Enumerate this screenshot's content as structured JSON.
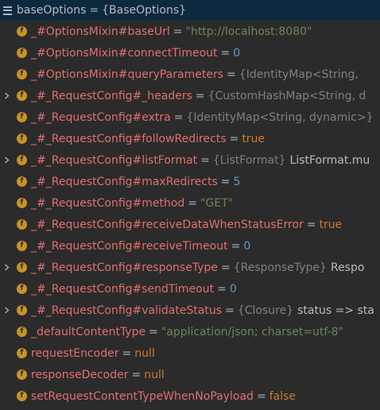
{
  "root": {
    "name": "baseOptions",
    "type": "{BaseOptions}"
  },
  "rows": [
    {
      "name": "_#OptionsMixin#baseUrl",
      "kind": "str",
      "value": "\"http://localhost:8080\"",
      "expandable": false
    },
    {
      "name": "_#OptionsMixin#connectTimeout",
      "kind": "num",
      "value": "0",
      "expandable": false
    },
    {
      "name": "_#OptionsMixin#queryParameters",
      "kind": "type",
      "type": "{IdentityMap<String,",
      "value": "",
      "expandable": false
    },
    {
      "name": "_#_RequestConfig#_headers",
      "kind": "type",
      "type": "{CustomHashMap<String, d",
      "value": "",
      "expandable": true
    },
    {
      "name": "_#_RequestConfig#extra",
      "kind": "type",
      "type": "{IdentityMap<String, dynamic>}",
      "value": "",
      "expandable": false
    },
    {
      "name": "_#_RequestConfig#followRedirects",
      "kind": "kw",
      "value": "true",
      "expandable": false
    },
    {
      "name": "_#_RequestConfig#listFormat",
      "kind": "type",
      "type": "{ListFormat}",
      "value": "ListFormat.mu",
      "expandable": true
    },
    {
      "name": "_#_RequestConfig#maxRedirects",
      "kind": "num",
      "value": "5",
      "expandable": false
    },
    {
      "name": "_#_RequestConfig#method",
      "kind": "str",
      "value": "\"GET\"",
      "expandable": false
    },
    {
      "name": "_#_RequestConfig#receiveDataWhenStatusError",
      "kind": "kw",
      "value": "true",
      "expandable": false
    },
    {
      "name": "_#_RequestConfig#receiveTimeout",
      "kind": "num",
      "value": "0",
      "expandable": false
    },
    {
      "name": "_#_RequestConfig#responseType",
      "kind": "type",
      "type": "{ResponseType}",
      "value": "Respo",
      "expandable": true
    },
    {
      "name": "_#_RequestConfig#sendTimeout",
      "kind": "num",
      "value": "0",
      "expandable": false
    },
    {
      "name": "_#_RequestConfig#validateStatus",
      "kind": "type",
      "type": "{Closure}",
      "value": "status => sta",
      "expandable": true
    },
    {
      "name": "_defaultContentType",
      "kind": "str",
      "value": "\"application/json; charset=utf-8\"",
      "expandable": false
    },
    {
      "name": "requestEncoder",
      "kind": "kw",
      "value": "null",
      "expandable": false
    },
    {
      "name": "responseDecoder",
      "kind": "kw",
      "value": "null",
      "expandable": false
    },
    {
      "name": "setRequestContentTypeWhenNoPayload",
      "kind": "kw",
      "value": "false",
      "expandable": false
    }
  ],
  "labels": {
    "equals": "=",
    "field_icon": "f"
  },
  "icons": {
    "root": "list-icon",
    "field": "field-icon",
    "expand": "chevron-right-icon"
  },
  "colors": {
    "background": "#2b2b2b",
    "selection": "#0d293e",
    "field_name": "#e26f6f",
    "string": "#6a8759",
    "number": "#6897bb",
    "keyword": "#cc7832",
    "type": "#808080",
    "field_icon": "#c89326"
  }
}
